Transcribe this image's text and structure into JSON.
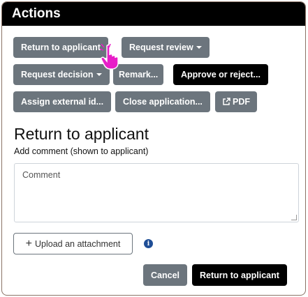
{
  "header": {
    "title": "Actions"
  },
  "toolbar": {
    "return_to_applicant": "Return to applicant",
    "request_review": "Request review",
    "request_decision": "Request decision",
    "remark": "Remark...",
    "approve_or_reject": "Approve or reject...",
    "assign_external_id": "Assign external id...",
    "close_application": "Close application...",
    "pdf": "PDF"
  },
  "form": {
    "title": "Return to applicant",
    "comment_label": "Add comment (shown to applicant)",
    "comment_placeholder": "Comment",
    "upload_label": "Upload an attachment",
    "info_glyph": "i",
    "cancel_label": "Cancel",
    "submit_label": "Return to applicant"
  },
  "colors": {
    "secondary": "#6c757d",
    "primary": "#000000",
    "info": "#1f4e96",
    "cursor": "#e81ec8"
  },
  "icons": [
    "caret-down-icon",
    "external-link-icon",
    "plus-icon",
    "info-icon",
    "hand-pointer-cursor"
  ]
}
